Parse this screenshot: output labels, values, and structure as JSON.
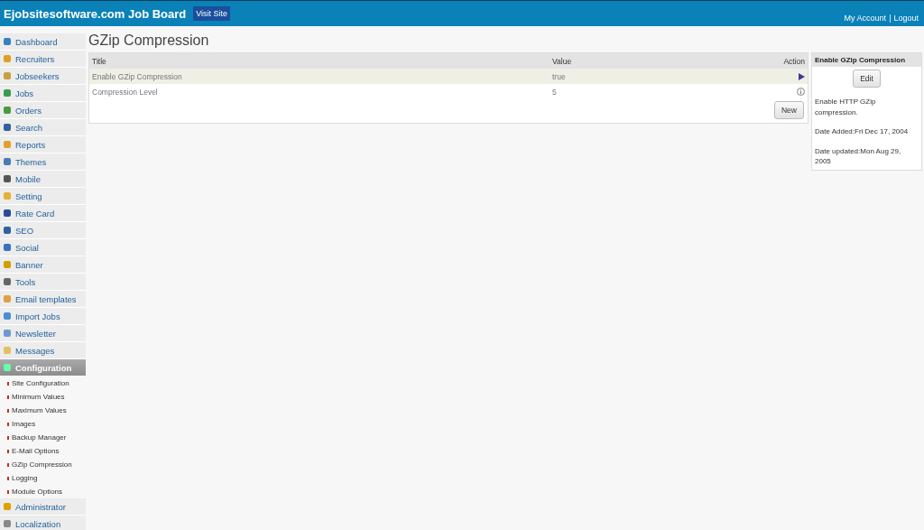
{
  "header": {
    "title": "Ejobsitesoftware.com Job Board",
    "visit_button": "Visit Site",
    "links": [
      "My Account",
      "Logout"
    ],
    "separator": "|"
  },
  "sidebar": {
    "items": [
      {
        "label": "Dashboard",
        "selected": false
      },
      {
        "label": "Recruiters",
        "selected": false
      },
      {
        "label": "Jobseekers",
        "selected": false
      },
      {
        "label": "Jobs",
        "selected": false
      },
      {
        "label": "Orders",
        "selected": false
      },
      {
        "label": "Search",
        "selected": false
      },
      {
        "label": "Reports",
        "selected": false
      },
      {
        "label": "Themes",
        "selected": false
      },
      {
        "label": "Mobile",
        "selected": false
      },
      {
        "label": "Setting",
        "selected": false
      },
      {
        "label": "Rate Card",
        "selected": false
      },
      {
        "label": "SEO",
        "selected": false
      },
      {
        "label": "Social",
        "selected": false
      },
      {
        "label": "Banner",
        "selected": false
      },
      {
        "label": "Tools",
        "selected": false
      },
      {
        "label": "Email templates",
        "selected": false
      },
      {
        "label": "Import Jobs",
        "selected": false
      },
      {
        "label": "Newsletter",
        "selected": false
      },
      {
        "label": "Messages",
        "selected": false
      },
      {
        "label": "Configuration",
        "selected": true,
        "children": [
          {
            "label": "Site Configuration"
          },
          {
            "label": "Minimum Values"
          },
          {
            "label": "Maximum Values"
          },
          {
            "label": "Images"
          },
          {
            "label": "Backup Manager"
          },
          {
            "label": "E-Mail Options"
          },
          {
            "label": "GZip Compression"
          },
          {
            "label": "Logging"
          },
          {
            "label": "Module Options"
          }
        ]
      },
      {
        "label": "Administrator",
        "selected": false
      },
      {
        "label": "Localization",
        "selected": false
      }
    ]
  },
  "page_title": "GZip Compression",
  "table": {
    "columns": [
      "Title",
      "Value",
      "Action"
    ],
    "rows": [
      {
        "title": "Enable GZip Compression",
        "value": "true",
        "selected": true,
        "kind": "arrow"
      },
      {
        "title": "Compression Level",
        "value": "5",
        "selected": false,
        "kind": "info"
      }
    ],
    "new_button": "New"
  },
  "details": {
    "title": "Enable GZip Compression",
    "edit_button": "Edit",
    "description": "Enable HTTP GZip compression.",
    "date_added": "Date Added:Fri Dec 17, 2004",
    "date_updated": "Date updated:Mon Aug 29, 2005"
  }
}
